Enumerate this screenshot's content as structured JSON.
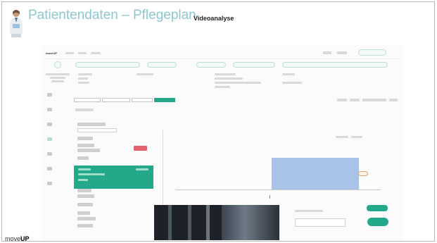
{
  "slide": {
    "title": "Patientendaten – Pflegeplan",
    "subtitle": "Videoanalyse",
    "footer_logo_light": "move",
    "footer_logo_bold": "UP"
  },
  "colors": {
    "title": "#8ec7cf",
    "accent_green": "#23a98a",
    "danger_red": "#e4606c",
    "plot_bar": "#a8c2e8"
  },
  "embedded_app": {
    "logo": "moveUP",
    "note": ""
  }
}
